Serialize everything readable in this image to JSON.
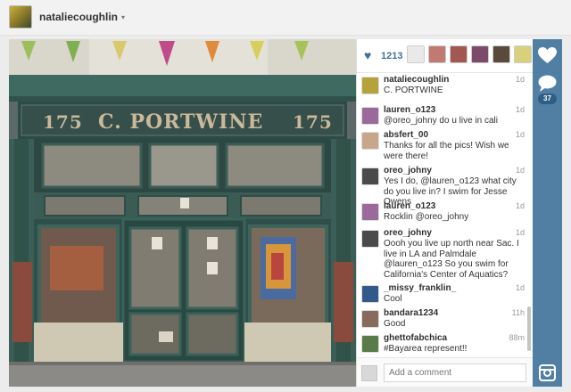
{
  "header": {
    "username": "nataliecoughlin",
    "caret": "▾"
  },
  "photo": {
    "sign_number_left": "175",
    "sign_name": "C. PORTWINE",
    "sign_number_right": "175"
  },
  "likes": {
    "count": "1213",
    "icon": "heart-icon"
  },
  "caption": {
    "user": "nataliecoughlin",
    "time": "1d",
    "text": "C. PORTWINE"
  },
  "comments": [
    {
      "user": "lauren_o123",
      "time": "1d",
      "text": "@oreo_johny do u live in cali"
    },
    {
      "user": "absfert_00",
      "time": "1d",
      "text": "Thanks for all the pics! Wish we were there!"
    },
    {
      "user": "oreo_johny",
      "time": "1d",
      "text": "Yes I do, @lauren_o123 what city do you live in? I swim for Jesse Owens"
    },
    {
      "user": "lauren_o123",
      "time": "1d",
      "text": "Rocklin @oreo_johny"
    },
    {
      "user": "oreo_johny",
      "time": "1d",
      "text": "Oooh you live up north near Sac. I live in LA and Palmdale @lauren_o123 So you swim for California's Center of Aquatics?"
    },
    {
      "user": "_missy_franklin_",
      "time": "1d",
      "text": "Cool"
    },
    {
      "user": "bandara1234",
      "time": "11h",
      "text": "Good"
    },
    {
      "user": "ghettofabchica",
      "time": "88m",
      "text": "#Bayarea represent!!"
    }
  ],
  "comment_input": {
    "placeholder": "Add a comment"
  },
  "sidebar": {
    "like_icon": "heart-icon",
    "comment_icon": "speech-bubble-icon",
    "comment_count": "37",
    "instagram_icon": "instagram-icon"
  },
  "colors": {
    "accent": "#3f729b",
    "sidebar": "#517fa4"
  }
}
